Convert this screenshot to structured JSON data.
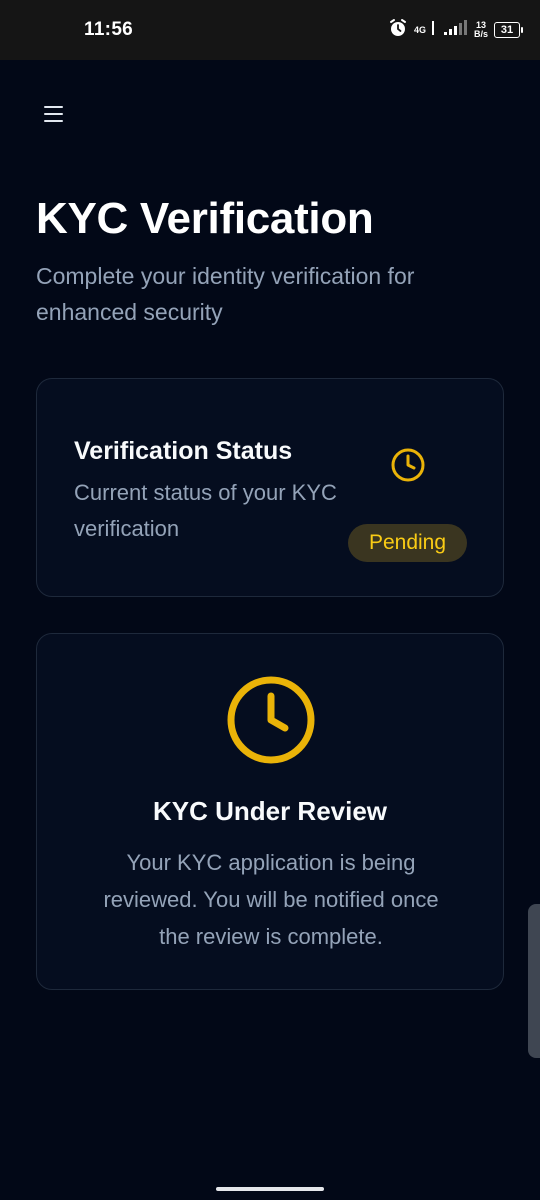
{
  "status_bar": {
    "time": "11:56",
    "network_type": "4G",
    "data_rate_value": "13",
    "data_rate_unit": "B/s",
    "battery": "31",
    "icons": [
      "alarm-icon",
      "signal-icon",
      "battery-icon"
    ]
  },
  "header": {
    "menu_icon": "menu-icon"
  },
  "page": {
    "title": "KYC Verification",
    "subtitle": "Complete your identity verification for enhanced security"
  },
  "status_card": {
    "title": "Verification Status",
    "description": "Current status of your KYC verification",
    "icon": "clock-icon",
    "badge": "Pending"
  },
  "review_card": {
    "icon": "clock-icon",
    "title": "KYC Under Review",
    "description": "Your KYC application is being reviewed. You will be notified once the review is complete."
  },
  "colors": {
    "background": "#020817",
    "card": "#050d1f",
    "card_border": "#1e293b",
    "accent": "#eab308",
    "muted_text": "#94a3b8"
  }
}
